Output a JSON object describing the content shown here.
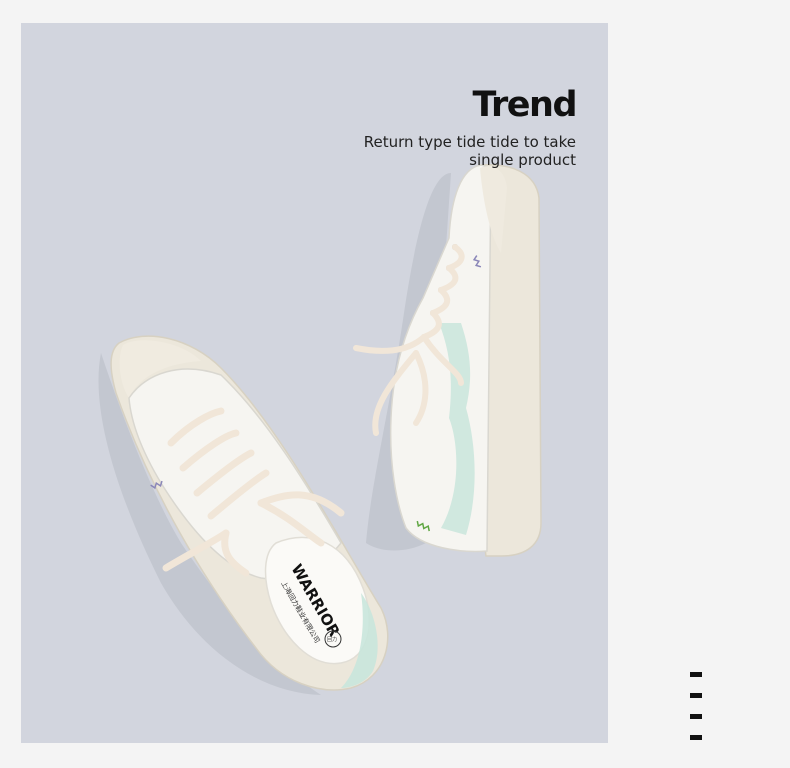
{
  "headline": {
    "title": "Trend",
    "subtitle": "Return type tide tide to take single product"
  },
  "shoe": {
    "brand": "WARRIOR",
    "maker": "上海回力鞋业有限公司",
    "logo_mark": "回力"
  },
  "colors": {
    "panel_background": "#d2d5de",
    "page_background": "#f4f4f4",
    "shoe_canvas": "#f4f3ee",
    "lace": "#f1e6d8",
    "mint_accent": "#c9e5dc",
    "green_stitch": "#5fa642",
    "purple_stitch": "#8a86b8"
  },
  "decoration": {
    "dash_count": 4
  }
}
